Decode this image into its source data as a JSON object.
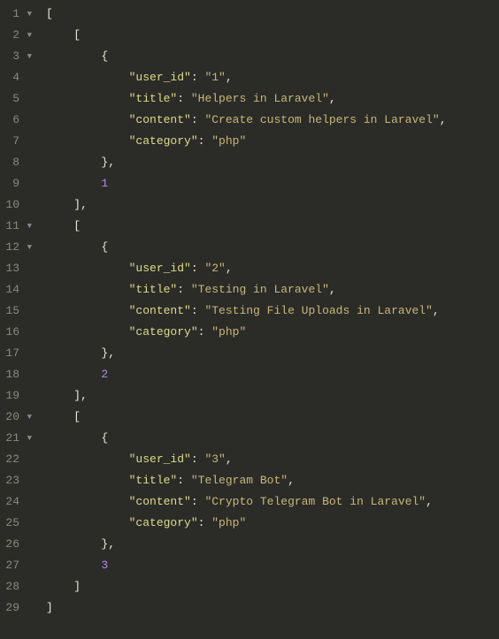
{
  "gutter": {
    "foldable_lines": [
      1,
      2,
      3,
      11,
      12,
      20,
      21
    ],
    "fold_glyph": "▼"
  },
  "lines": [
    {
      "n": 1,
      "indent": 0,
      "tokens": [
        {
          "t": "bracket",
          "v": "["
        }
      ]
    },
    {
      "n": 2,
      "indent": 1,
      "tokens": [
        {
          "t": "bracket",
          "v": "["
        }
      ]
    },
    {
      "n": 3,
      "indent": 2,
      "tokens": [
        {
          "t": "bracket",
          "v": "{"
        }
      ]
    },
    {
      "n": 4,
      "indent": 3,
      "tokens": [
        {
          "t": "key",
          "v": "\"user_id\""
        },
        {
          "t": "punct",
          "v": ": "
        },
        {
          "t": "str",
          "v": "\"1\""
        },
        {
          "t": "punct",
          "v": ","
        }
      ]
    },
    {
      "n": 5,
      "indent": 3,
      "tokens": [
        {
          "t": "key",
          "v": "\"title\""
        },
        {
          "t": "punct",
          "v": ": "
        },
        {
          "t": "str",
          "v": "\"Helpers in Laravel\""
        },
        {
          "t": "punct",
          "v": ","
        }
      ]
    },
    {
      "n": 6,
      "indent": 3,
      "tokens": [
        {
          "t": "key",
          "v": "\"content\""
        },
        {
          "t": "punct",
          "v": ": "
        },
        {
          "t": "str",
          "v": "\"Create custom helpers in Laravel\""
        },
        {
          "t": "punct",
          "v": ","
        }
      ]
    },
    {
      "n": 7,
      "indent": 3,
      "tokens": [
        {
          "t": "key",
          "v": "\"category\""
        },
        {
          "t": "punct",
          "v": ": "
        },
        {
          "t": "str",
          "v": "\"php\""
        }
      ]
    },
    {
      "n": 8,
      "indent": 2,
      "tokens": [
        {
          "t": "bracket",
          "v": "}"
        },
        {
          "t": "punct",
          "v": ","
        }
      ]
    },
    {
      "n": 9,
      "indent": 2,
      "tokens": [
        {
          "t": "num",
          "v": "1"
        }
      ]
    },
    {
      "n": 10,
      "indent": 1,
      "tokens": [
        {
          "t": "bracket",
          "v": "]"
        },
        {
          "t": "punct",
          "v": ","
        }
      ]
    },
    {
      "n": 11,
      "indent": 1,
      "tokens": [
        {
          "t": "bracket",
          "v": "["
        }
      ]
    },
    {
      "n": 12,
      "indent": 2,
      "tokens": [
        {
          "t": "bracket",
          "v": "{"
        }
      ]
    },
    {
      "n": 13,
      "indent": 3,
      "tokens": [
        {
          "t": "key",
          "v": "\"user_id\""
        },
        {
          "t": "punct",
          "v": ": "
        },
        {
          "t": "str",
          "v": "\"2\""
        },
        {
          "t": "punct",
          "v": ","
        }
      ]
    },
    {
      "n": 14,
      "indent": 3,
      "tokens": [
        {
          "t": "key",
          "v": "\"title\""
        },
        {
          "t": "punct",
          "v": ": "
        },
        {
          "t": "str",
          "v": "\"Testing in Laravel\""
        },
        {
          "t": "punct",
          "v": ","
        }
      ]
    },
    {
      "n": 15,
      "indent": 3,
      "tokens": [
        {
          "t": "key",
          "v": "\"content\""
        },
        {
          "t": "punct",
          "v": ": "
        },
        {
          "t": "str",
          "v": "\"Testing File Uploads in Laravel\""
        },
        {
          "t": "punct",
          "v": ","
        }
      ]
    },
    {
      "n": 16,
      "indent": 3,
      "tokens": [
        {
          "t": "key",
          "v": "\"category\""
        },
        {
          "t": "punct",
          "v": ": "
        },
        {
          "t": "str",
          "v": "\"php\""
        }
      ]
    },
    {
      "n": 17,
      "indent": 2,
      "tokens": [
        {
          "t": "bracket",
          "v": "}"
        },
        {
          "t": "punct",
          "v": ","
        }
      ]
    },
    {
      "n": 18,
      "indent": 2,
      "tokens": [
        {
          "t": "num",
          "v": "2"
        }
      ]
    },
    {
      "n": 19,
      "indent": 1,
      "tokens": [
        {
          "t": "bracket",
          "v": "]"
        },
        {
          "t": "punct",
          "v": ","
        }
      ]
    },
    {
      "n": 20,
      "indent": 1,
      "tokens": [
        {
          "t": "bracket",
          "v": "["
        }
      ]
    },
    {
      "n": 21,
      "indent": 2,
      "tokens": [
        {
          "t": "bracket",
          "v": "{"
        }
      ]
    },
    {
      "n": 22,
      "indent": 3,
      "tokens": [
        {
          "t": "key",
          "v": "\"user_id\""
        },
        {
          "t": "punct",
          "v": ": "
        },
        {
          "t": "str",
          "v": "\"3\""
        },
        {
          "t": "punct",
          "v": ","
        }
      ]
    },
    {
      "n": 23,
      "indent": 3,
      "tokens": [
        {
          "t": "key",
          "v": "\"title\""
        },
        {
          "t": "punct",
          "v": ": "
        },
        {
          "t": "str",
          "v": "\"Telegram Bot\""
        },
        {
          "t": "punct",
          "v": ","
        }
      ]
    },
    {
      "n": 24,
      "indent": 3,
      "tokens": [
        {
          "t": "key",
          "v": "\"content\""
        },
        {
          "t": "punct",
          "v": ": "
        },
        {
          "t": "str",
          "v": "\"Crypto Telegram Bot in Laravel\""
        },
        {
          "t": "punct",
          "v": ","
        }
      ]
    },
    {
      "n": 25,
      "indent": 3,
      "tokens": [
        {
          "t": "key",
          "v": "\"category\""
        },
        {
          "t": "punct",
          "v": ": "
        },
        {
          "t": "str",
          "v": "\"php\""
        }
      ]
    },
    {
      "n": 26,
      "indent": 2,
      "tokens": [
        {
          "t": "bracket",
          "v": "}"
        },
        {
          "t": "punct",
          "v": ","
        }
      ]
    },
    {
      "n": 27,
      "indent": 2,
      "tokens": [
        {
          "t": "num",
          "v": "3"
        }
      ]
    },
    {
      "n": 28,
      "indent": 1,
      "tokens": [
        {
          "t": "bracket",
          "v": "]"
        }
      ]
    },
    {
      "n": 29,
      "indent": 0,
      "tokens": [
        {
          "t": "bracket",
          "v": "]"
        }
      ]
    }
  ]
}
